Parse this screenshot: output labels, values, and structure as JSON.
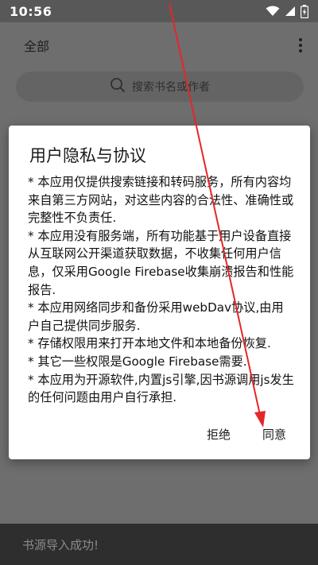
{
  "status_bar": {
    "time": "10:56",
    "icons": [
      "wifi-icon",
      "signal-icon",
      "battery-icon"
    ]
  },
  "app_bar": {
    "title": "全部",
    "menu_icon": "more-vert-icon"
  },
  "search": {
    "placeholder": "搜索书名或作者",
    "icon": "search-icon"
  },
  "dialog": {
    "title": "用户隐私与协议",
    "paragraphs": [
      "* 本应用仅提供搜索链接和转码服务，所有内容均来自第三方网站，对这些内容的合法性、准确性或完整性不负责任.",
      "* 本应用没有服务端，所有功能基于用户设备直接从互联网公开渠道获取数据，不收集任何用户信息，仅采用Google Firebase收集崩溃报告和性能报告.",
      "* 本应用网络同步和备份采用webDav协议,由用户自己提供同步服务.",
      "* 存储权限用来打开本地文件和本地备份恢复.",
      "* 其它一些权限是Google Firebase需要.",
      "* 本应用为开源软件,内置js引擎,因书源调用js发生的任何问题由用户自行承担."
    ],
    "reject_label": "拒绝",
    "accept_label": "同意"
  },
  "toast": {
    "message": "书源导入成功!"
  },
  "colors": {
    "scrim": "#6e6e6e",
    "annotation_arrow": "#e5262a"
  }
}
